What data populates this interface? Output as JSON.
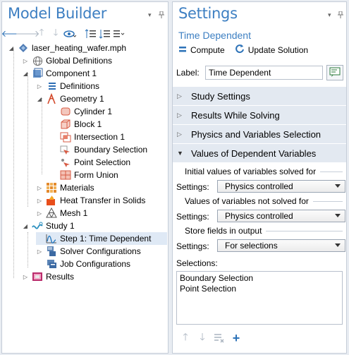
{
  "model_builder": {
    "title": "Model Builder",
    "tree": [
      {
        "label": "laser_heating_wafer.mph",
        "icon": "mph-file-icon"
      },
      {
        "label": "Global Definitions",
        "icon": "globe-icon"
      },
      {
        "label": "Component 1",
        "icon": "component-icon"
      },
      {
        "label": "Definitions",
        "icon": "definitions-icon"
      },
      {
        "label": "Geometry 1",
        "icon": "geometry-icon"
      },
      {
        "label": "Cylinder 1",
        "icon": "cylinder-icon"
      },
      {
        "label": "Block 1",
        "icon": "block-icon"
      },
      {
        "label": "Intersection 1",
        "icon": "intersection-icon"
      },
      {
        "label": "Boundary Selection",
        "icon": "boundary-selection-icon"
      },
      {
        "label": "Point Selection",
        "icon": "point-selection-icon"
      },
      {
        "label": "Form Union",
        "icon": "form-union-icon"
      },
      {
        "label": "Materials",
        "icon": "materials-icon"
      },
      {
        "label": "Heat Transfer in Solids",
        "icon": "heat-transfer-icon"
      },
      {
        "label": "Mesh 1",
        "icon": "mesh-icon"
      },
      {
        "label": "Study 1",
        "icon": "study-icon"
      },
      {
        "label": "Step 1: Time Dependent",
        "icon": "time-dependent-icon"
      },
      {
        "label": "Solver Configurations",
        "icon": "solver-configurations-icon"
      },
      {
        "label": "Job Configurations",
        "icon": "job-configurations-icon"
      },
      {
        "label": "Results",
        "icon": "results-icon"
      }
    ]
  },
  "settings": {
    "title": "Settings",
    "subtitle": "Time Dependent",
    "compute_label": "Compute",
    "update_label": "Update Solution",
    "label_caption": "Label:",
    "label_value": "Time Dependent",
    "sections": [
      {
        "label": "Study Settings",
        "expanded": false
      },
      {
        "label": "Results While Solving",
        "expanded": false
      },
      {
        "label": "Physics and Variables Selection",
        "expanded": false
      },
      {
        "label": "Values of Dependent Variables",
        "expanded": true
      }
    ],
    "groups": {
      "initial": "Initial values of variables solved for",
      "not_solved": "Values of variables not solved for",
      "store": "Store fields in output"
    },
    "settings_caption": "Settings:",
    "initial_value": "Physics controlled",
    "not_solved_value": "Physics controlled",
    "store_value": "For selections",
    "selections_caption": "Selections:",
    "selections": [
      "Boundary Selection",
      "Point Selection"
    ]
  },
  "colors": {
    "accent": "#3d7fc2",
    "section_bg": "#e3e9f1",
    "selected_row": "#dfe9f5"
  }
}
